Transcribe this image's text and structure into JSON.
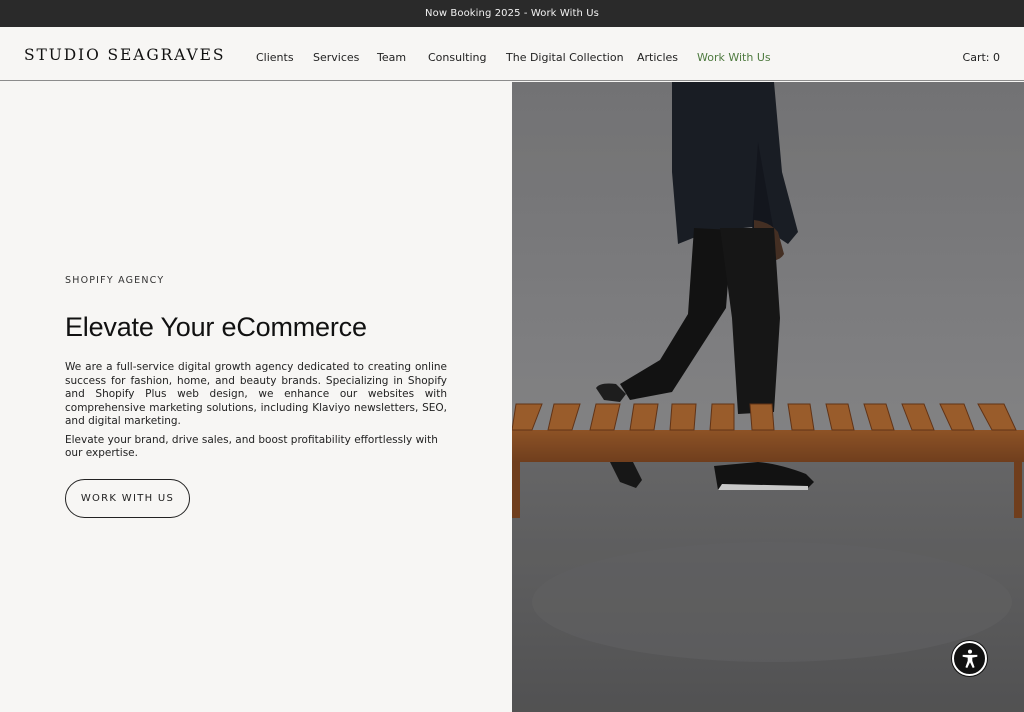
{
  "announcement": {
    "text": "Now Booking 2025 - Work With Us"
  },
  "header": {
    "logo": "STUDIO SEAGRAVES",
    "nav": [
      {
        "label": "Clients"
      },
      {
        "label": "Services"
      },
      {
        "label": "Team"
      },
      {
        "label": "Consulting"
      },
      {
        "label": "The Digital Collection"
      },
      {
        "label": "Articles"
      },
      {
        "label": "Work With Us",
        "active": true
      }
    ],
    "cart": "Cart: 0"
  },
  "hero": {
    "eyebrow": "SHOPIFY AGENCY",
    "headline": "Elevate Your eCommerce",
    "paragraphs": [
      "We are a full-service digital growth agency dedicated to creating online success for fashion, home, and beauty brands. Specializing in Shopify and Shopify Plus web design, we enhance our websites with comprehensive marketing solutions, including Klaviyo newsletters, SEO, and digital marketing.",
      "Elevate your brand, drive sales, and boost profitability effortlessly with our expertise."
    ],
    "cta": "WORK WITH US"
  },
  "colors": {
    "announcement_bg": "#2a2a2a",
    "page_bg": "#f7f6f4",
    "active_nav": "#4e7a3f"
  },
  "icons": {
    "accessibility": "accessibility-icon"
  }
}
